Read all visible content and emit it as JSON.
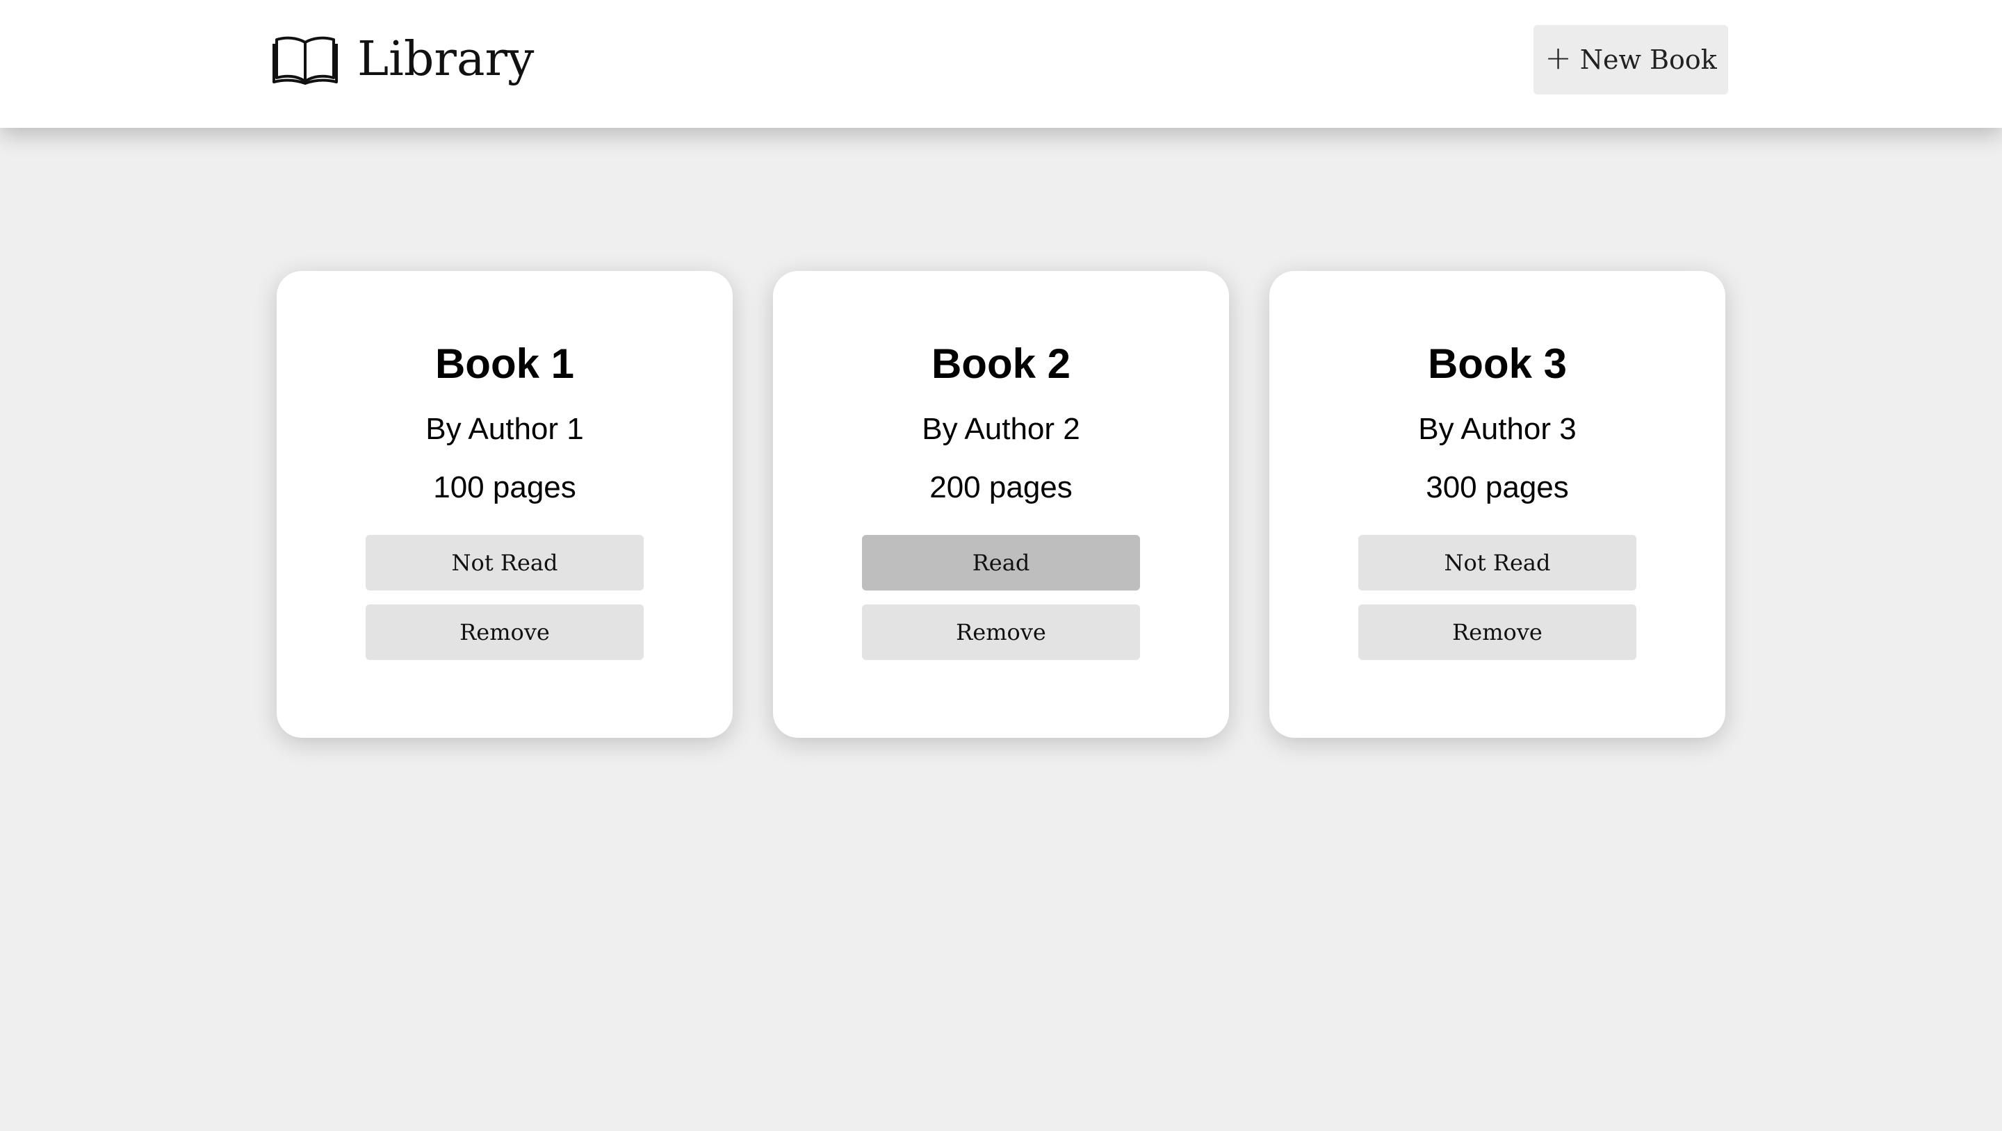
{
  "header": {
    "title": "Library",
    "logo_icon": "open-book-icon",
    "new_book_label": "New Book",
    "new_book_icon": "plus-icon",
    "new_book_icon_glyph": "+"
  },
  "books": [
    {
      "title": "Book 1",
      "author": "By Author 1",
      "pages": "100 pages",
      "status": "Not Read",
      "remove_label": "Remove",
      "read": false
    },
    {
      "title": "Book 2",
      "author": "By Author 2",
      "pages": "200 pages",
      "status": "Read",
      "remove_label": "Remove",
      "read": true
    },
    {
      "title": "Book 3",
      "author": "By Author 3",
      "pages": "300 pages",
      "status": "Not Read",
      "remove_label": "Remove",
      "read": false
    }
  ],
  "colors": {
    "page_background": "#efefef",
    "header_background": "#ffffff",
    "card_background": "#ffffff",
    "button_background": "#e3e3e3",
    "read_button_background": "#bebebe"
  }
}
